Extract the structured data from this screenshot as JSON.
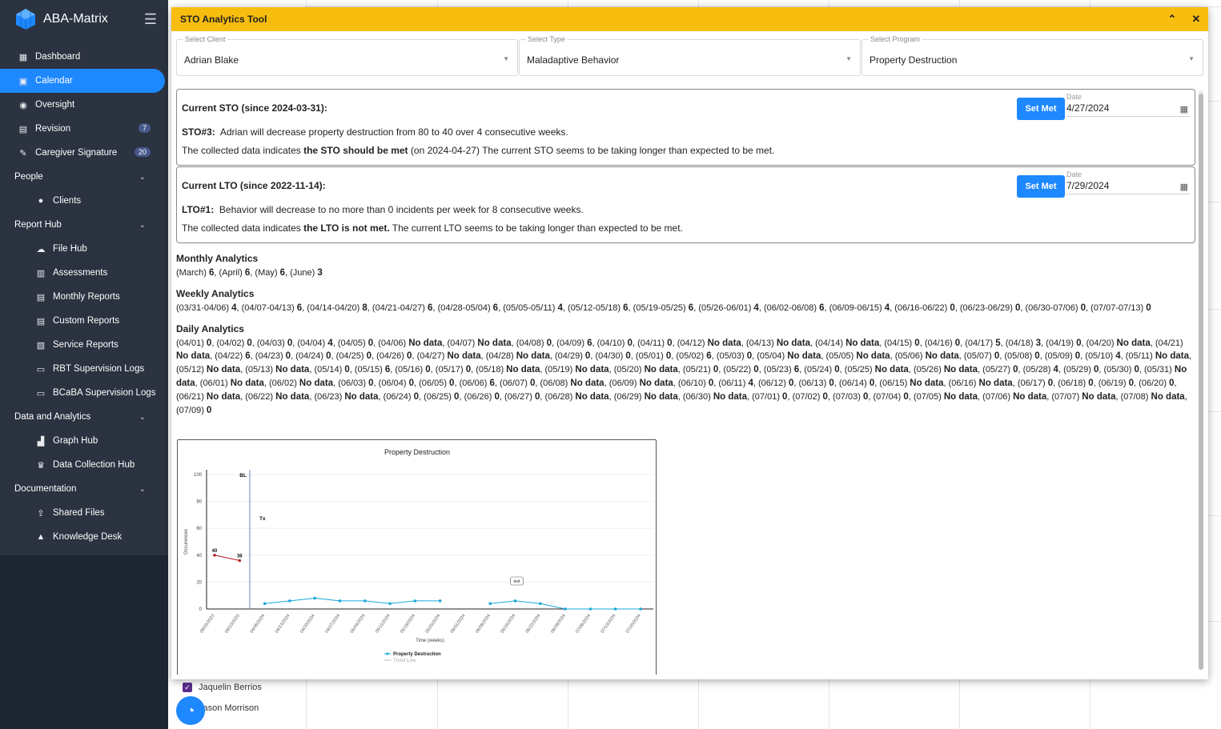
{
  "app": {
    "name": "ABA-Matrix"
  },
  "sidebar": {
    "items": [
      {
        "label": "Dashboard",
        "icon": "grid-icon",
        "type": "item"
      },
      {
        "label": "Calendar",
        "icon": "calendar-icon",
        "type": "item",
        "active": true
      },
      {
        "label": "Oversight",
        "icon": "eye-icon",
        "type": "item"
      },
      {
        "label": "Revision",
        "icon": "document-icon",
        "type": "item",
        "badge": "7"
      },
      {
        "label": "Caregiver Signature",
        "icon": "pen-icon",
        "type": "item",
        "badge": "20"
      },
      {
        "label": "People",
        "type": "section"
      },
      {
        "label": "Clients",
        "icon": "person-icon",
        "type": "sub"
      },
      {
        "label": "Report Hub",
        "type": "section"
      },
      {
        "label": "File Hub",
        "icon": "cloud-icon",
        "type": "sub"
      },
      {
        "label": "Assessments",
        "icon": "clipboard-icon",
        "type": "sub"
      },
      {
        "label": "Monthly Reports",
        "icon": "report-icon",
        "type": "sub"
      },
      {
        "label": "Custom Reports",
        "icon": "file-icon",
        "type": "sub"
      },
      {
        "label": "Service Reports",
        "icon": "file-edit-icon",
        "type": "sub"
      },
      {
        "label": "RBT Supervision Logs",
        "icon": "monitor-icon",
        "type": "sub"
      },
      {
        "label": "BCaBA Supervision Logs",
        "icon": "monitor-icon",
        "type": "sub"
      },
      {
        "label": "Data and Analytics",
        "type": "section"
      },
      {
        "label": "Graph Hub",
        "icon": "bar-chart-icon",
        "type": "sub"
      },
      {
        "label": "Data Collection Hub",
        "icon": "trophy-icon",
        "type": "sub"
      },
      {
        "label": "Documentation",
        "type": "section"
      },
      {
        "label": "Shared Files",
        "icon": "share-icon",
        "type": "sub"
      },
      {
        "label": "Knowledge Desk",
        "icon": "graduation-icon",
        "type": "sub"
      }
    ]
  },
  "background": {
    "names": [
      "Jaquelin Berrios",
      "Jason Morrison"
    ]
  },
  "modal": {
    "title": "STO Analytics Tool",
    "selects": [
      {
        "label": "Select Client",
        "value": "Adrian Blake"
      },
      {
        "label": "Select Type",
        "value": "Maladaptive Behavior"
      },
      {
        "label": "Select Program",
        "value": "Property Destruction"
      }
    ],
    "sto": {
      "heading": "Current STO (since 2024-03-31):",
      "id": "STO#3:",
      "text": "Adrian will decrease property destruction from 80 to 40 over 4 consecutive weeks.",
      "status_pre": "The collected data indicates ",
      "status_bold": "the STO should be met",
      "status_post": " (on 2024-04-27) The current STO seems to be taking longer than expected to be met.",
      "button": "Set Met",
      "date_label": "Date",
      "date_value": "4/27/2024"
    },
    "lto": {
      "heading": "Current LTO (since 2022-11-14):",
      "id": "LTO#1:",
      "text": "Behavior will decrease to no more than 0 incidents per week for 8 consecutive weeks.",
      "status_pre": "The collected data indicates ",
      "status_bold": "the LTO is not met.",
      "status_post": " The current LTO seems to be taking longer than expected to be met.",
      "button": "Set Met",
      "date_label": "Date",
      "date_value": "7/29/2024"
    },
    "monthly": {
      "title": "Monthly Analytics",
      "entries": [
        [
          "(March)",
          "6"
        ],
        [
          "(April)",
          "6"
        ],
        [
          "(May)",
          "6"
        ],
        [
          "(June)",
          "3"
        ]
      ]
    },
    "weekly": {
      "title": "Weekly Analytics",
      "entries": [
        [
          "(03/31-04/06)",
          "4"
        ],
        [
          "(04/07-04/13)",
          "6"
        ],
        [
          "(04/14-04/20)",
          "8"
        ],
        [
          "(04/21-04/27)",
          "6"
        ],
        [
          "(04/28-05/04)",
          "6"
        ],
        [
          "(05/05-05/11)",
          "4"
        ],
        [
          "(05/12-05/18)",
          "6"
        ],
        [
          "(05/19-05/25)",
          "6"
        ],
        [
          "(05/26-06/01)",
          "4"
        ],
        [
          "(06/02-06/08)",
          "6"
        ],
        [
          "(06/09-06/15)",
          "4"
        ],
        [
          "(06/16-06/22)",
          "0"
        ],
        [
          "(06/23-06/29)",
          "0"
        ],
        [
          "(06/30-07/06)",
          "0"
        ],
        [
          "(07/07-07/13)",
          "0"
        ]
      ]
    },
    "daily": {
      "title": "Daily Analytics",
      "entries": [
        [
          "(04/01)",
          "0"
        ],
        [
          "(04/02)",
          "0"
        ],
        [
          "(04/03)",
          "0"
        ],
        [
          "(04/04)",
          "4"
        ],
        [
          "(04/05)",
          "0"
        ],
        [
          "(04/06)",
          "No data"
        ],
        [
          "(04/07)",
          "No data"
        ],
        [
          "(04/08)",
          "0"
        ],
        [
          "(04/09)",
          "6"
        ],
        [
          "(04/10)",
          "0"
        ],
        [
          "(04/11)",
          "0"
        ],
        [
          "(04/12)",
          "No data"
        ],
        [
          "(04/13)",
          "No data"
        ],
        [
          "(04/14)",
          "No data"
        ],
        [
          "(04/15)",
          "0"
        ],
        [
          "(04/16)",
          "0"
        ],
        [
          "(04/17)",
          "5"
        ],
        [
          "(04/18)",
          "3"
        ],
        [
          "(04/19)",
          "0"
        ],
        [
          "(04/20)",
          "No data"
        ],
        [
          "(04/21)",
          "No data"
        ],
        [
          "(04/22)",
          "6"
        ],
        [
          "(04/23)",
          "0"
        ],
        [
          "(04/24)",
          "0"
        ],
        [
          "(04/25)",
          "0"
        ],
        [
          "(04/26)",
          "0"
        ],
        [
          "(04/27)",
          "No data"
        ],
        [
          "(04/28)",
          "No data"
        ],
        [
          "(04/29)",
          "0"
        ],
        [
          "(04/30)",
          "0"
        ],
        [
          "(05/01)",
          "0"
        ],
        [
          "(05/02)",
          "6"
        ],
        [
          "(05/03)",
          "0"
        ],
        [
          "(05/04)",
          "No data"
        ],
        [
          "(05/05)",
          "No data"
        ],
        [
          "(05/06)",
          "No data"
        ],
        [
          "(05/07)",
          "0"
        ],
        [
          "(05/08)",
          "0"
        ],
        [
          "(05/09)",
          "0"
        ],
        [
          "(05/10)",
          "4"
        ],
        [
          "(05/11)",
          "No data"
        ],
        [
          "(05/12)",
          "No data"
        ],
        [
          "(05/13)",
          "No data"
        ],
        [
          "(05/14)",
          "0"
        ],
        [
          "(05/15)",
          "6"
        ],
        [
          "(05/16)",
          "0"
        ],
        [
          "(05/17)",
          "0"
        ],
        [
          "(05/18)",
          "No data"
        ],
        [
          "(05/19)",
          "No data"
        ],
        [
          "(05/20)",
          "No data"
        ],
        [
          "(05/21)",
          "0"
        ],
        [
          "(05/22)",
          "0"
        ],
        [
          "(05/23)",
          "6"
        ],
        [
          "(05/24)",
          "0"
        ],
        [
          "(05/25)",
          "No data"
        ],
        [
          "(05/26)",
          "No data"
        ],
        [
          "(05/27)",
          "0"
        ],
        [
          "(05/28)",
          "4"
        ],
        [
          "(05/29)",
          "0"
        ],
        [
          "(05/30)",
          "0"
        ],
        [
          "(05/31)",
          "No data"
        ],
        [
          "(06/01)",
          "No data"
        ],
        [
          "(06/02)",
          "No data"
        ],
        [
          "(06/03)",
          "0"
        ],
        [
          "(06/04)",
          "0"
        ],
        [
          "(06/05)",
          "0"
        ],
        [
          "(06/06)",
          "6"
        ],
        [
          "(06/07)",
          "0"
        ],
        [
          "(06/08)",
          "No data"
        ],
        [
          "(06/09)",
          "No data"
        ],
        [
          "(06/10)",
          "0"
        ],
        [
          "(06/11)",
          "4"
        ],
        [
          "(06/12)",
          "0"
        ],
        [
          "(06/13)",
          "0"
        ],
        [
          "(06/14)",
          "0"
        ],
        [
          "(06/15)",
          "No data"
        ],
        [
          "(06/16)",
          "No data"
        ],
        [
          "(06/17)",
          "0"
        ],
        [
          "(06/18)",
          "0"
        ],
        [
          "(06/19)",
          "0"
        ],
        [
          "(06/20)",
          "0"
        ],
        [
          "(06/21)",
          "No data"
        ],
        [
          "(06/22)",
          "No data"
        ],
        [
          "(06/23)",
          "No data"
        ],
        [
          "(06/24)",
          "0"
        ],
        [
          "(06/25)",
          "0"
        ],
        [
          "(06/26)",
          "0"
        ],
        [
          "(06/27)",
          "0"
        ],
        [
          "(06/28)",
          "No data"
        ],
        [
          "(06/29)",
          "No data"
        ],
        [
          "(06/30)",
          "No data"
        ],
        [
          "(07/01)",
          "0"
        ],
        [
          "(07/02)",
          "0"
        ],
        [
          "(07/03)",
          "0"
        ],
        [
          "(07/04)",
          "0"
        ],
        [
          "(07/05)",
          "No data"
        ],
        [
          "(07/06)",
          "No data"
        ],
        [
          "(07/07)",
          "No data"
        ],
        [
          "(07/08)",
          "No data"
        ],
        [
          "(07/09)",
          "0"
        ]
      ]
    }
  },
  "chart_data": {
    "type": "line",
    "title": "Property Destruction",
    "xlabel": "Time (weeks)",
    "ylabel": "Occurences",
    "ylim": [
      0,
      100
    ],
    "yticks": [
      0,
      20,
      40,
      60,
      80,
      100
    ],
    "categories": [
      "09/03/2023",
      "09/10/2023",
      "04/06/2024",
      "04/13/2024",
      "04/20/2024",
      "04/27/2024",
      "05/04/2024",
      "05/11/2024",
      "05/18/2024",
      "05/25/2024",
      "06/01/2024",
      "06/08/2024",
      "06/15/2024",
      "06/22/2024",
      "06/29/2024",
      "07/06/2024",
      "07/13/2024",
      "07/20/2024"
    ],
    "phase_labels": [
      "BL",
      "Tx"
    ],
    "annotation": "text",
    "baseline": {
      "values": [
        40,
        36
      ],
      "labels": [
        "40",
        "36"
      ],
      "color": "#b22222"
    },
    "series": [
      {
        "name": "Property Destruction",
        "color": "#1aa7d8",
        "values": [
          null,
          null,
          4,
          6,
          8,
          6,
          6,
          4,
          6,
          6,
          null,
          4,
          6,
          4,
          0,
          0,
          0,
          0
        ]
      }
    ],
    "legend": [
      "Property Destruction",
      "Trend Line"
    ],
    "legend_position": "bottom",
    "grid": true
  }
}
